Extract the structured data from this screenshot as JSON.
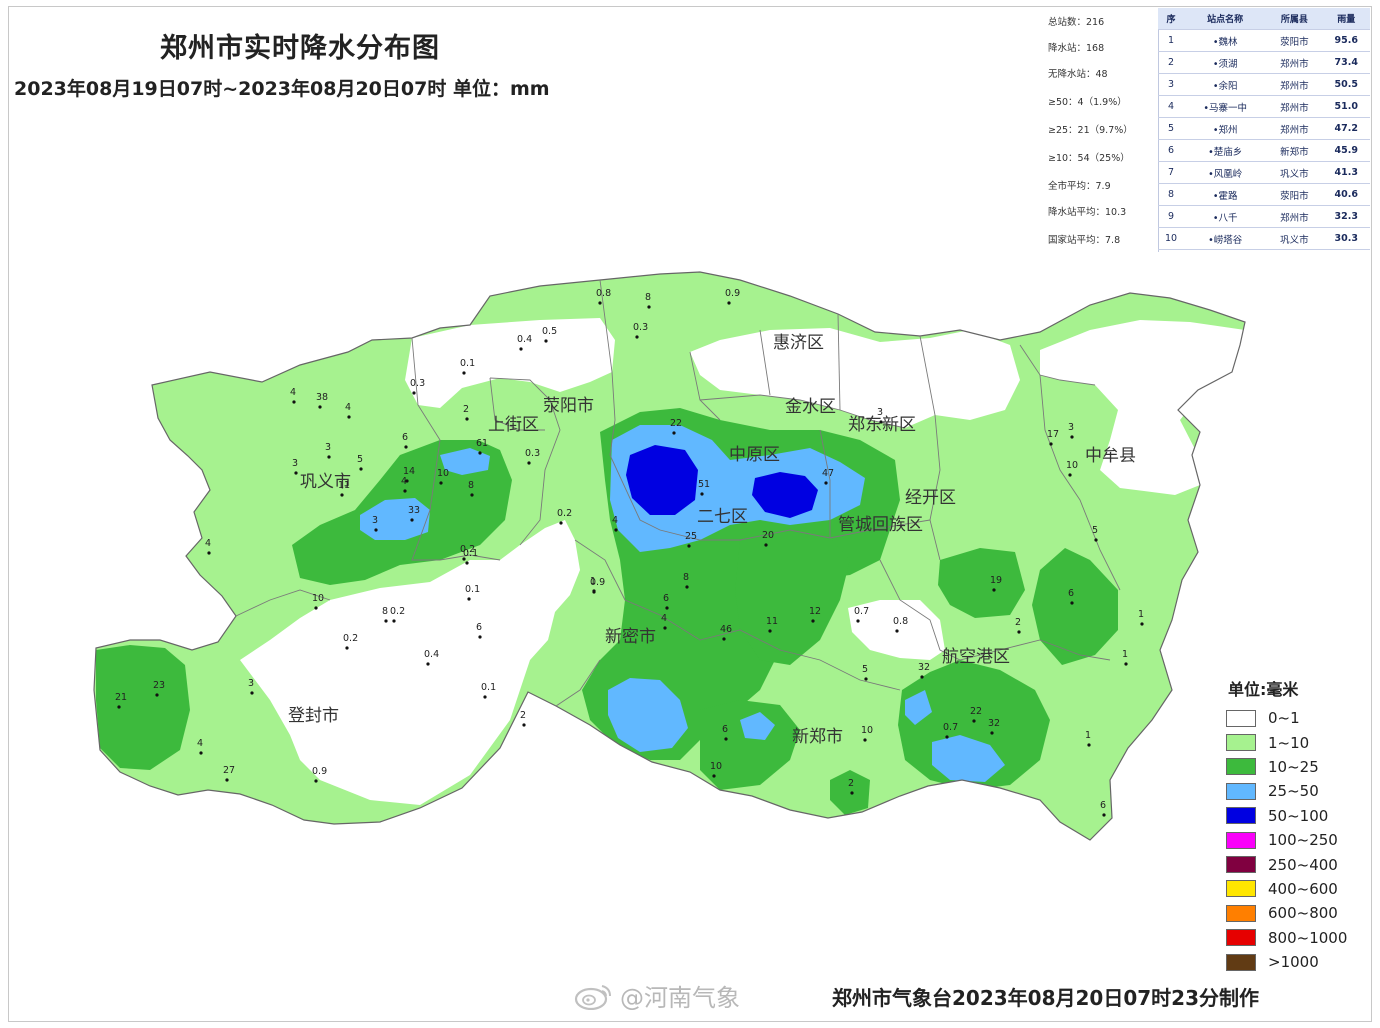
{
  "header": {
    "title": "郑州市实时降水分布图",
    "subtitle": "2023年08月19日07时~2023年08月20日07时 单位：mm"
  },
  "stats": [
    "总站数：216",
    "降水站：168",
    "无降水站：48",
    "≥50：4（1.9%）",
    "≥25：21（9.7%）",
    "≥10：54（25%）",
    "全市平均：7.9",
    "降水站平均：10.3",
    "国家站平均：7.8"
  ],
  "ranking": {
    "headers": [
      "序",
      "站点名称",
      "所属县",
      "雨量"
    ],
    "rows": [
      [
        "1",
        "•魏林",
        "荥阳市",
        "95.6"
      ],
      [
        "2",
        "•须湖",
        "郑州市",
        "73.4"
      ],
      [
        "3",
        "•余阳",
        "郑州市",
        "50.5"
      ],
      [
        "4",
        "•马寨一中",
        "郑州市",
        "51.0"
      ],
      [
        "5",
        "•郑州",
        "郑州市",
        "47.2"
      ],
      [
        "6",
        "•楚庙乡",
        "新郑市",
        "45.9"
      ],
      [
        "7",
        "•风凰岭",
        "巩义市",
        "41.3"
      ],
      [
        "8",
        "•霍路",
        "荥阳市",
        "40.6"
      ],
      [
        "9",
        "•八千",
        "郑州市",
        "32.3"
      ],
      [
        "10",
        "•崂塔谷",
        "巩义市",
        "30.3"
      ]
    ]
  },
  "districts": [
    "惠济区",
    "金水区",
    "郑东新区",
    "中牟县",
    "巩义市",
    "上街区",
    "荥阳市",
    "中原区",
    "二七区",
    "管城回族区",
    "经开区",
    "新密市",
    "登封市",
    "新郑市",
    "航空港区"
  ],
  "legend": {
    "title": "单位:毫米",
    "items": [
      {
        "label": "0~1",
        "color": "#ffffff"
      },
      {
        "label": "1~10",
        "color": "#a6f28f"
      },
      {
        "label": "10~25",
        "color": "#3dba3d"
      },
      {
        "label": "25~50",
        "color": "#61b8ff"
      },
      {
        "label": "50~100",
        "color": "#0000e1"
      },
      {
        "label": "100~250",
        "color": "#fa00fa"
      },
      {
        "label": "250~400",
        "color": "#800040"
      },
      {
        "label": "400~600",
        "color": "#ffe600"
      },
      {
        "label": "600~800",
        "color": "#ff7f00"
      },
      {
        "label": "800~1000",
        "color": "#e60000"
      },
      {
        "label": ">1000",
        "color": "#613b14"
      }
    ]
  },
  "station_values": [
    "0.8",
    "8",
    "0.9",
    "0.4",
    "0.5",
    "0.3",
    "0.1",
    "0.3",
    "4",
    "38",
    "4",
    "2",
    "3",
    "5",
    "6",
    "3",
    "11",
    "4",
    "0.1",
    "0.3",
    "61",
    "14",
    "10",
    "33",
    "3",
    "8",
    "0.2",
    "22",
    "51",
    "4",
    "47",
    "3",
    "17",
    "3",
    "10",
    "5",
    "6",
    "19",
    "4",
    "10",
    "8",
    "0.2",
    "0.1",
    "6",
    "0.9",
    "6",
    "4",
    "20",
    "11",
    "12",
    "0.7",
    "0.8",
    "2",
    "1",
    "5",
    "21",
    "23",
    "3",
    "0.2",
    "0.4",
    "0.2",
    "0.1",
    "2",
    "4",
    "27",
    "25",
    "8",
    "46",
    "32",
    "0.7",
    "22",
    "32",
    "10",
    "6",
    "10",
    "2",
    "0.9",
    "1",
    "1",
    "6",
    "1"
  ],
  "footer": "郑州市气象台2023年08月20日07时23分制作",
  "watermark": "@河南气象"
}
